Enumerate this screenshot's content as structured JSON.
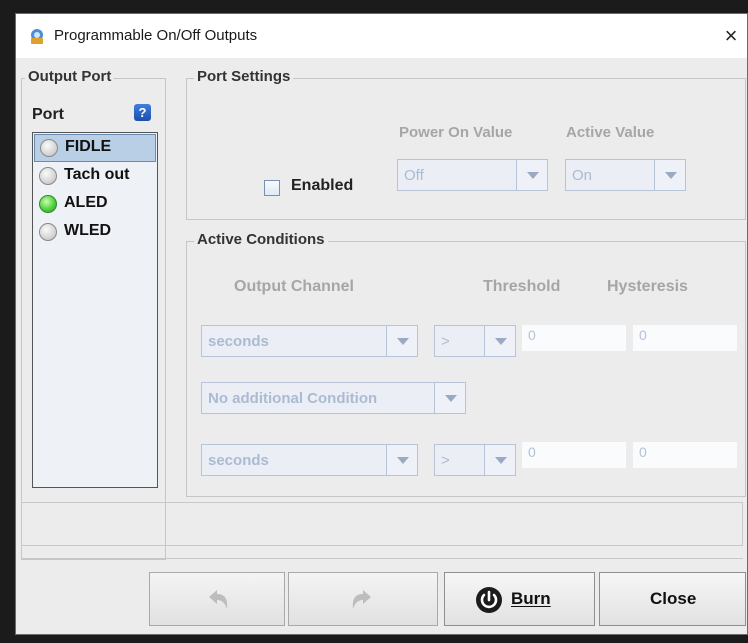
{
  "window": {
    "title": "Programmable On/Off Outputs",
    "close_glyph": "×"
  },
  "output_port": {
    "legend": "Output Port",
    "port_label": "Port",
    "help_glyph": "?",
    "ports": [
      {
        "label": "FIDLE",
        "selected": true,
        "led": "off"
      },
      {
        "label": "Tach out",
        "selected": false,
        "led": "off"
      },
      {
        "label": "ALED",
        "selected": false,
        "led": "on"
      },
      {
        "label": "WLED",
        "selected": false,
        "led": "off"
      }
    ]
  },
  "port_settings": {
    "legend": "Port Settings",
    "enabled_label": "Enabled",
    "power_on_value_label": "Power On Value",
    "active_value_label": "Active Value",
    "power_on_value": "Off",
    "active_value": "On"
  },
  "active_conditions": {
    "legend": "Active Conditions",
    "col_output_channel": "Output Channel",
    "col_threshold": "Threshold",
    "col_hysteresis": "Hysteresis",
    "row1": {
      "channel": "seconds",
      "operator": ">",
      "threshold": "0",
      "hysteresis": "0"
    },
    "additional_condition": "No additional Condition",
    "row2": {
      "channel": "seconds",
      "operator": ">",
      "threshold": "0",
      "hysteresis": "0"
    }
  },
  "buttons": {
    "undo_icon": "undo-icon",
    "redo_icon": "redo-icon",
    "burn_label": "Burn",
    "close_label": "Close"
  },
  "colors": {
    "selected_row": "#b8cfe5",
    "led_on": "#55d040",
    "disabled_text": "#aabbd2"
  }
}
